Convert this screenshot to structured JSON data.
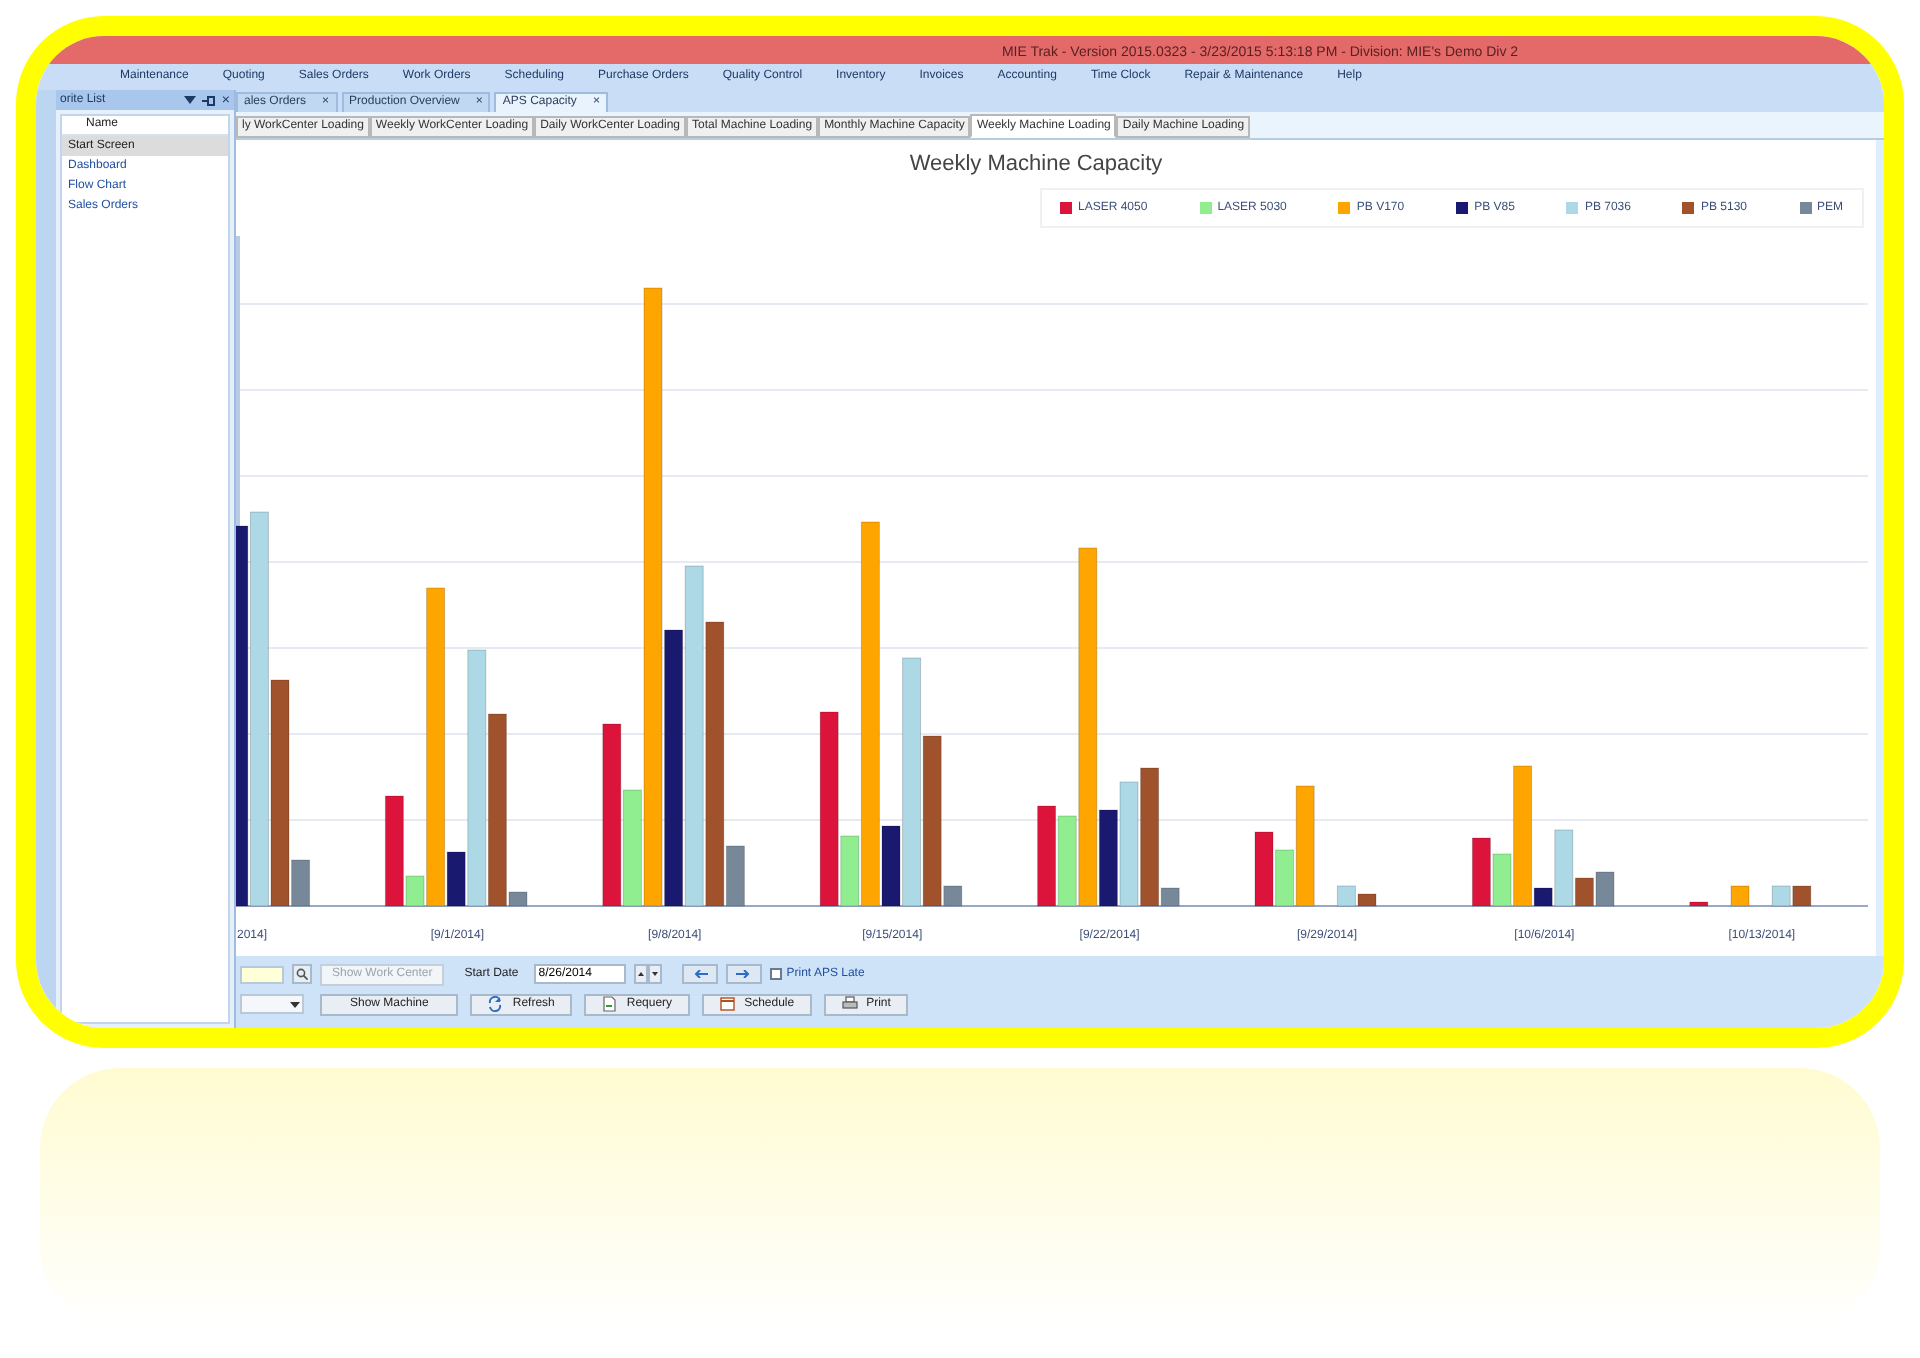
{
  "window": {
    "title": "MIE Trak - Version 2015.0323 - 3/23/2015 5:13:18 PM - Division: MIE's Demo Div 2"
  },
  "menu": [
    "Maintenance",
    "Quoting",
    "Sales Orders",
    "Work Orders",
    "Scheduling",
    "Purchase Orders",
    "Quality Control",
    "Inventory",
    "Invoices",
    "Accounting",
    "Time Clock",
    "Repair & Maintenance",
    "Help"
  ],
  "sidebar": {
    "title": "orite List",
    "close": "×",
    "column": "Name",
    "items": [
      {
        "label": "Start Screen",
        "selected": true
      },
      {
        "label": "Dashboard",
        "selected": false
      },
      {
        "label": "Flow Chart",
        "selected": false
      },
      {
        "label": "Sales Orders",
        "selected": false
      }
    ]
  },
  "document_tabs": [
    {
      "label": "ales Orders",
      "close": "×",
      "selected": false
    },
    {
      "label": "Production Overview",
      "close": "×",
      "selected": false
    },
    {
      "label": "APS Capacity",
      "close": "×",
      "selected": true
    }
  ],
  "view_tabs": [
    {
      "label": "ly WorkCenter Loading",
      "selected": false
    },
    {
      "label": "Weekly WorkCenter Loading",
      "selected": false
    },
    {
      "label": "Daily WorkCenter Loading",
      "selected": false
    },
    {
      "label": "Total Machine Loading",
      "selected": false
    },
    {
      "label": "Monthly Machine Capacity",
      "selected": false
    },
    {
      "label": "Weekly Machine Loading",
      "selected": true
    },
    {
      "label": "Daily Machine Loading",
      "selected": false
    }
  ],
  "chart": {
    "title": "Weekly Machine Capacity",
    "legend": [
      {
        "label": "LASER 4050",
        "color": "#dc143c"
      },
      {
        "label": "LASER 5030",
        "color": "#90ee90"
      },
      {
        "label": "PB V170",
        "color": "#ffa500"
      },
      {
        "label": "PB V85",
        "color": "#191970"
      },
      {
        "label": "PB 7036",
        "color": "#add8e6"
      },
      {
        "label": "PB 5130",
        "color": "#a0522d"
      },
      {
        "label": "PEM",
        "color": "#778899"
      }
    ],
    "categories": [
      "2014]",
      "[9/1/2014]",
      "[9/8/2014]",
      "[9/15/2014]",
      "[9/22/2014]",
      "[9/29/2014]",
      "[10/6/2014]",
      "[10/13/2014]"
    ]
  },
  "toolbar": {
    "show_work_center": {
      "label": "Show Work Center",
      "disabled": true
    },
    "start_date_label": "Start Date",
    "start_date": "8/26/2014",
    "print_late": {
      "label": "Print APS Late",
      "checked": false
    },
    "show_machine": {
      "label": "Show Machine",
      "disabled": false
    },
    "buttons": [
      {
        "kind": "refresh",
        "label": "Refresh"
      },
      {
        "kind": "requery",
        "label": "Requery"
      },
      {
        "kind": "schedule",
        "label": "Schedule"
      },
      {
        "kind": "print",
        "label": "Print"
      }
    ]
  }
}
